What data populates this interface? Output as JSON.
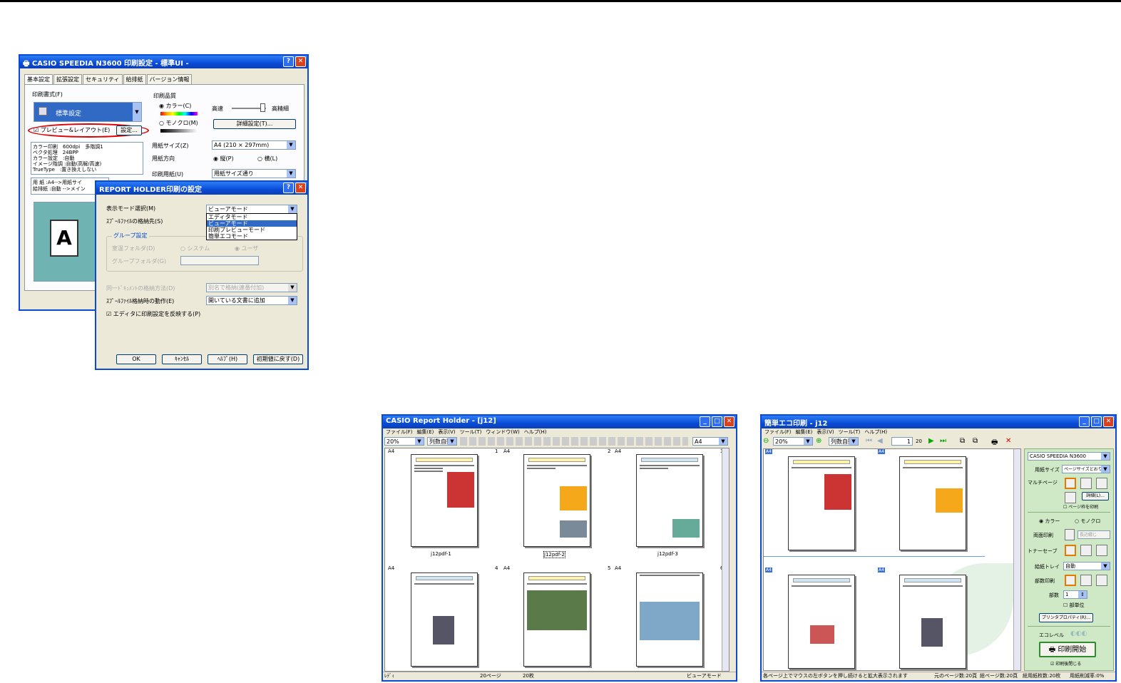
{
  "dialog1": {
    "title": "CASIO SPEEDIA N3600 印刷設定 - 標準UI -",
    "tabs": [
      "基本設定",
      "拡張設定",
      "セキュリティ",
      "給排紙",
      "バージョン情報"
    ],
    "print_style_label": "印刷書式(F)",
    "print_style_value": "標準設定",
    "preview_checkbox": "プレビュー&レイアウト(E)",
    "settings_button": "設定...",
    "info_lines": [
      "カラー印刷　600dpi　多階調1",
      "ベクタ処理　24BPP",
      "カラー設定　:自動",
      "イメージ階調 :自動(高解/高速)",
      "TrueType　:置き換えしない"
    ],
    "paper_lines": [
      "用 紙 :A4-->用紙サイ",
      "給排紙 :自動 -->メイン"
    ],
    "quality_group": "印刷品質",
    "color_radio": "カラー(C)",
    "mono_radio": "モノクロ(M)",
    "speed_label": "高速",
    "fine_label": "高精細",
    "detail_button": "詳細設定(T)...",
    "paper_size_label": "用紙サイズ(Z)",
    "paper_size_value": "A4 (210 × 297mm)",
    "orientation_label": "用紙方向",
    "portrait_radio": "縦(P)",
    "landscape_radio": "横(L)",
    "print_paper_label": "印刷用紙(U)",
    "print_paper_value": "用紙サイズ通り",
    "preview_letter": "A"
  },
  "dialog2": {
    "title": "REPORT HOLDER印刷の設定",
    "mode_label": "表示モード選択(M)",
    "mode_value": "ビューアモード",
    "mode_options": [
      "エディタモード",
      "ビューアモード",
      "印刷プレビューモード",
      "簡単エコモード"
    ],
    "spool_label": "ｽﾌﾟｰﾙﾌｧｲﾙの格納先(S)",
    "group_title": "グループ設定",
    "default_folder_label": "室温フォルダ(D)",
    "system_radio": "システム",
    "user_radio": "ユーザ",
    "group_folder_label": "グループフォルダ(G)",
    "doc_store_label": "同一ﾄﾞｷｭﾒﾝﾄの格納方法(D)",
    "doc_store_value": "別名で格納(連番付加)",
    "spool_action_label": "ｽﾌﾟｰﾙﾌｧｲﾙ格納時の動作(E)",
    "spool_action_value": "開いている文書に追加",
    "reflect_checkbox": "エディタに印刷設定を反映する(P)",
    "buttons": [
      "OK",
      "ｷｬﾝｾﾙ",
      "ﾍﾙﾌﾟ(H)",
      "初期値に戻す(D)"
    ]
  },
  "app1": {
    "title": "CASIO Report Holder - [j12]",
    "menu": [
      "ファイル(F)",
      "編集(E)",
      "表示(V)",
      "ツール(T)",
      "ウィンドウ(W)",
      "ヘルプ(H)"
    ],
    "zoom": "20%",
    "layout": "列数自動",
    "paper": "A4",
    "pages": [
      {
        "size": "A4",
        "num": "1",
        "label": "j12pdf-1"
      },
      {
        "size": "A4",
        "num": "2",
        "label": "j12pdf-2"
      },
      {
        "size": "A4",
        "num": "3",
        "label": "j12pdf-3"
      },
      {
        "size": "A4",
        "num": "4",
        "label": ""
      },
      {
        "size": "A4",
        "num": "5",
        "label": ""
      },
      {
        "size": "A4",
        "num": "6",
        "label": ""
      }
    ],
    "status": [
      "ﾚﾃﾞｨ",
      "20ページ",
      "20枚",
      "ビューアモード"
    ]
  },
  "app2": {
    "title": "簡単エコ印刷 - j12",
    "menu": [
      "ファイル(F)",
      "編集(E)",
      "表示(V)",
      "ツール(T)",
      "ヘルプ(H)"
    ],
    "zoom": "20%",
    "layout": "列数自動",
    "page_current": "1",
    "page_total": "20",
    "printer": "CASIO SPEEDIA N3600",
    "paper_size_label": "用紙サイズ",
    "paper_size_value": "ページサイズどおり",
    "multipage_label": "マルチページ",
    "detail_button": "詳細(L)...",
    "page_frame_check": "ページ枠を印刷",
    "color_radio": "カラー",
    "mono_radio": "モノクロ",
    "duplex_label": "両面印刷",
    "duplex_value": "長辺綴じ",
    "toner_label": "トナーセーブ",
    "tray_label": "給紙トレイ",
    "tray_value": "自動",
    "stamp_label": "部数印刷",
    "copies_label": "部数",
    "copies_value": "1",
    "collate_label": "部単位",
    "printer_props_button": "プリンタプロパティ(R)...",
    "eco_label": "エコレベル",
    "print_button": "印刷開始",
    "close_after_check": "印刷後閉じる",
    "status": [
      "各ページ上でマウスの左ボタンを押し続けると拡大表示されます",
      "元のページ数:20頁",
      "総ページ数:20頁",
      "総用紙枚数:20枚",
      "用紙削減率:0%"
    ],
    "page_tags": [
      "A4",
      "A4",
      "A4",
      "A4"
    ]
  }
}
